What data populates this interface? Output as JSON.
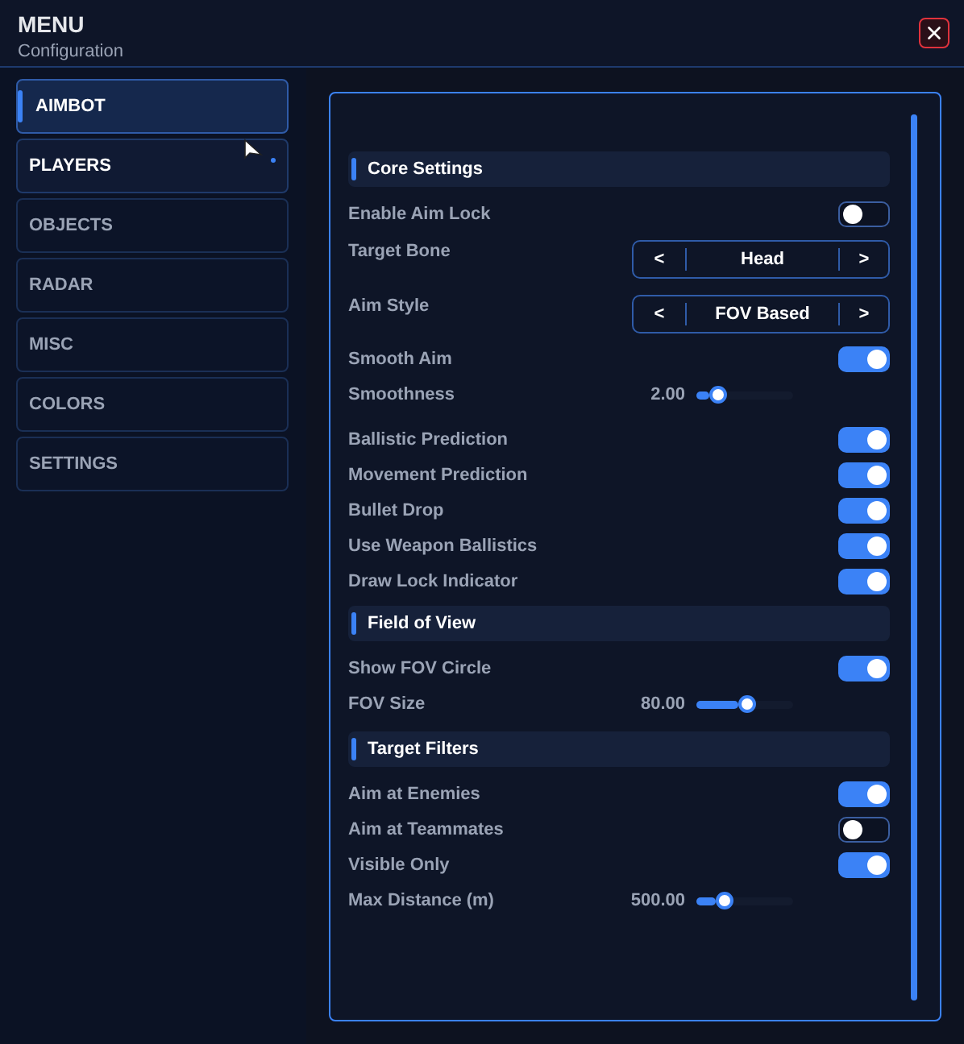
{
  "window": {
    "title": "MENU",
    "subtitle": "Configuration"
  },
  "sidebar": {
    "items": [
      {
        "label": "AIMBOT",
        "selected": true,
        "hovered": false
      },
      {
        "label": "PLAYERS",
        "selected": false,
        "hovered": true
      },
      {
        "label": "OBJECTS",
        "selected": false,
        "hovered": false
      },
      {
        "label": "RADAR",
        "selected": false,
        "hovered": false
      },
      {
        "label": "MISC",
        "selected": false,
        "hovered": false
      },
      {
        "label": "COLORS",
        "selected": false,
        "hovered": false
      },
      {
        "label": "SETTINGS",
        "selected": false,
        "hovered": false
      }
    ]
  },
  "settings": [
    {
      "kind": "section",
      "label": "Core Settings"
    },
    {
      "kind": "toggle",
      "label": "Enable Aim Lock",
      "on": false
    },
    {
      "kind": "selector",
      "label": "Target Bone",
      "prev": "<",
      "value": "Head",
      "next": ">"
    },
    {
      "kind": "selector",
      "label": "Aim Style",
      "prev": "<",
      "value": "FOV Based",
      "next": ">"
    },
    {
      "kind": "toggle",
      "label": "Smooth Aim",
      "on": true
    },
    {
      "kind": "slider",
      "label": "Smoothness",
      "reading": "2.00",
      "level": 0.13
    },
    {
      "kind": "toggle",
      "label": "Ballistic Prediction",
      "on": true
    },
    {
      "kind": "toggle",
      "label": "Movement Prediction",
      "on": true
    },
    {
      "kind": "toggle",
      "label": "Bullet Drop",
      "on": true
    },
    {
      "kind": "toggle",
      "label": "Use Weapon Ballistics",
      "on": true
    },
    {
      "kind": "toggle",
      "label": "Draw Lock Indicator",
      "on": true
    },
    {
      "kind": "section",
      "label": "Field of View"
    },
    {
      "kind": "toggle",
      "label": "Show FOV Circle",
      "on": true
    },
    {
      "kind": "slider",
      "label": "FOV Size",
      "reading": "80.00",
      "level": 0.43
    },
    {
      "kind": "section",
      "label": "Target Filters"
    },
    {
      "kind": "toggle",
      "label": "Aim at Enemies",
      "on": true
    },
    {
      "kind": "toggle",
      "label": "Aim at Teammates",
      "on": false
    },
    {
      "kind": "toggle",
      "label": "Visible Only",
      "on": true
    },
    {
      "kind": "slider",
      "label": "Max Distance (m)",
      "reading": "500.00",
      "level": 0.2
    }
  ]
}
